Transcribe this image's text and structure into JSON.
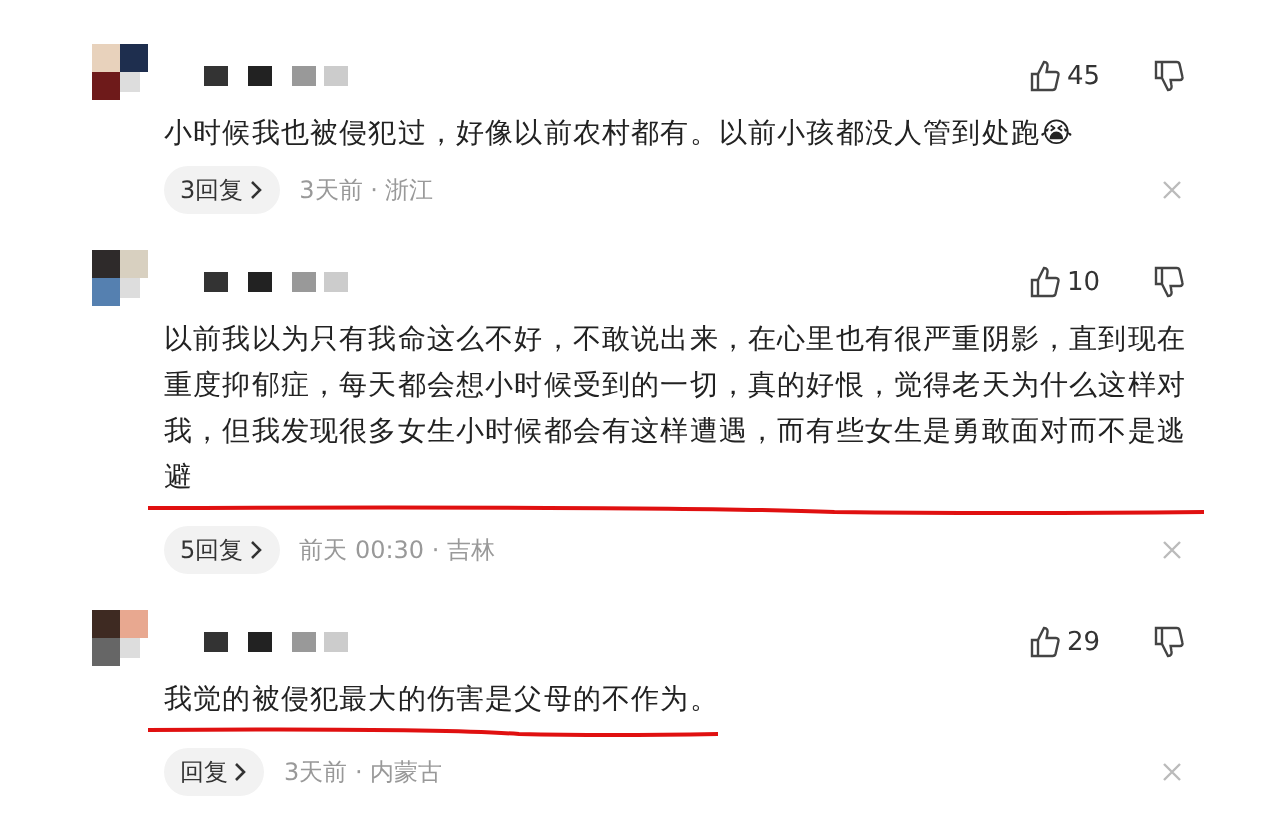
{
  "comments": [
    {
      "likes": "45",
      "text": "小时候我也被侵犯过，好像以前农村都有。以前小孩都没人管到处跑😭",
      "underlined": false,
      "replies": "3回复",
      "meta": "3天前 · 浙江"
    },
    {
      "likes": "10",
      "text": "以前我以为只有我命这么不好，不敢说出来，在心里也有很严重阴影，直到现在重度抑郁症，每天都会想小时候受到的一切，真的好恨，觉得老天为什么这样对我，但我发现很多女生小时候都会有这样遭遇，而有些女生是勇敢面对而不是逃避",
      "underlined": true,
      "replies": "5回复",
      "meta": "前天 00:30 · 吉林"
    },
    {
      "likes": "29",
      "text": "我觉的被侵犯最大的伤害是父母的不作为。",
      "underlined": true,
      "replies": "回复",
      "meta": "3天前 · 内蒙古"
    }
  ]
}
